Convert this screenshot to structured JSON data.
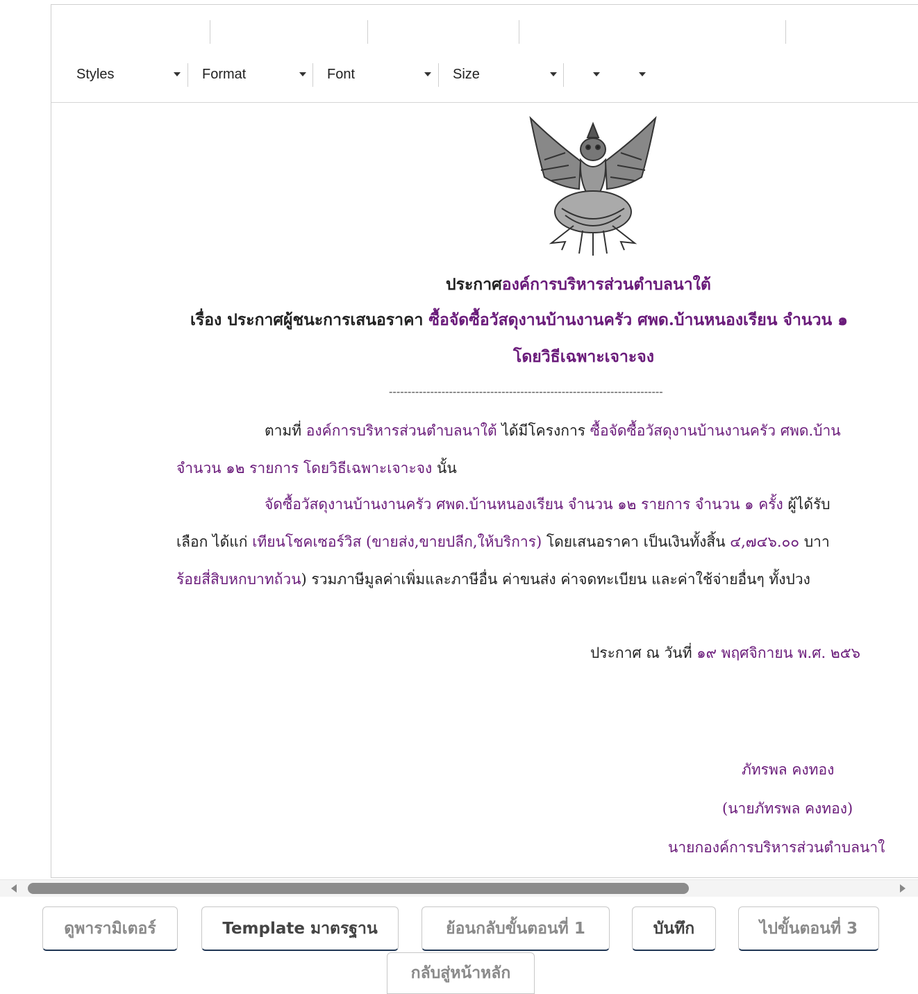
{
  "toolbar": {
    "styles": "Styles",
    "format": "Format",
    "font": "Font",
    "size": "Size"
  },
  "document": {
    "title": "ประกาศองค์การบริหารส่วนตำบลนาใต้",
    "title_prefix": "ประกาศ",
    "title_org": "องค์การบริหารส่วนตำบลนาใต้",
    "subject_prefix": "เรื่อง ประกาศผู้ชนะการเสนอราคา ",
    "subject_item": "ซื้อจัดซื้อวัสดุงานบ้านงานครัว ศพด.บ้านหนองเรียน จำนวน ๑",
    "subject_method": "โดยวิธีเฉพาะเจาะจง",
    "divider": "-------------------------------------------------------------------------",
    "p1_a": "ตามที่ ",
    "p1_org": "องค์การบริหารส่วนตำบลนาใต้",
    "p1_b": " ได้มีโครงการ ",
    "p1_item": "ซื้อจัดซื้อวัสดุงานบ้านงานครัว ศพด.บ้าน",
    "p1_line2_item": "จำนวน ๑๒ รายการ โดยวิธีเฉพาะเจาะจง",
    "p1_line2_end": "  นั้น",
    "p2_item": "จัดซื้อวัสดุงานบ้านงานครัว ศพด.บ้านหนองเรียน จำนวน ๑๒ รายการ จำนวน ๑ ครั้ง",
    "p2_end": " ผู้ได้รับ",
    "p3_a": "เลือก ได้แก่ ",
    "p3_vendor": "เทียนโชคเซอร์วิส (ขายส่ง,ขายปลีก,ให้บริการ)",
    "p3_b": " โดยเสนอราคา เป็นเงินทั้งสิ้น ",
    "p3_amount": "๔,๗๔๖.๐๐",
    "p3_c": " บาา",
    "p4_amount_text": "ร้อยสี่สิบหกบาทถ้วน",
    "p4_rest": ") รวมภาษีมูลค่าเพิ่มและภาษีอื่น ค่าขนส่ง ค่าจดทะเบียน และค่าใช้จ่ายอื่นๆ ทั้งปวง",
    "date_prefix": "ประกาศ ณ วันที่  ",
    "date_value": "๑๙ พฤศจิกายน พ.ศ. ๒๕๖",
    "signature": "ภัทรพล คงทอง",
    "signer_name": "(นายภัทรพล คงทอง)",
    "signer_position": "นายกองค์การบริหารส่วนตำบลนาใ"
  },
  "buttons": {
    "view_params": "ดูพารามิเตอร์",
    "template": "Template มาตรฐาน",
    "back_step1": "ย้อนกลับขั้นตอนที่ 1",
    "save": "บันทึก",
    "next_step3": "ไปขั้นตอนที่ 3",
    "home": "กลับสู่หน้าหลัก"
  },
  "colors": {
    "accent_text": "#6a1b7a",
    "button_border": "#1e3553"
  }
}
